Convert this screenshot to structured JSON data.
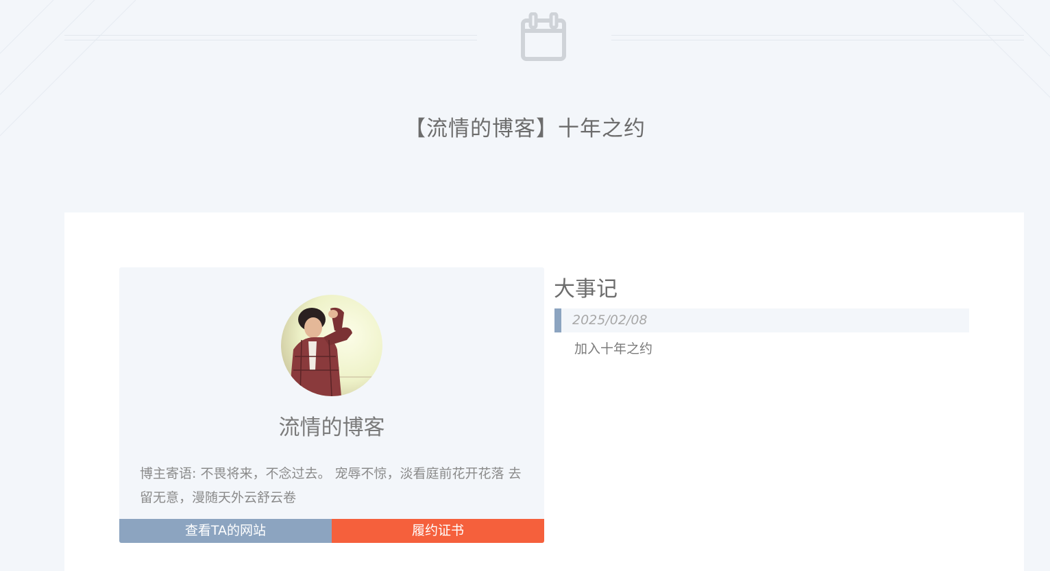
{
  "page": {
    "title": "【流情的博客】十年之约"
  },
  "profile": {
    "name": "流情的博客",
    "motto": "博主寄语: 不畏将来，不念过去。 宠辱不惊，淡看庭前花开花落 去留无意，漫随天外云舒云卷",
    "buttons": {
      "visit_site": "查看TA的网站",
      "certificate": "履约证书"
    }
  },
  "events": {
    "title": "大事记",
    "items": [
      {
        "date": "2025/02/08",
        "text": "加入十年之约"
      }
    ]
  },
  "colors": {
    "background": "#f3f6fa",
    "accent_blue": "#8ca4c0",
    "accent_orange": "#f5603c"
  },
  "icons": {
    "header": "calendar-icon"
  }
}
